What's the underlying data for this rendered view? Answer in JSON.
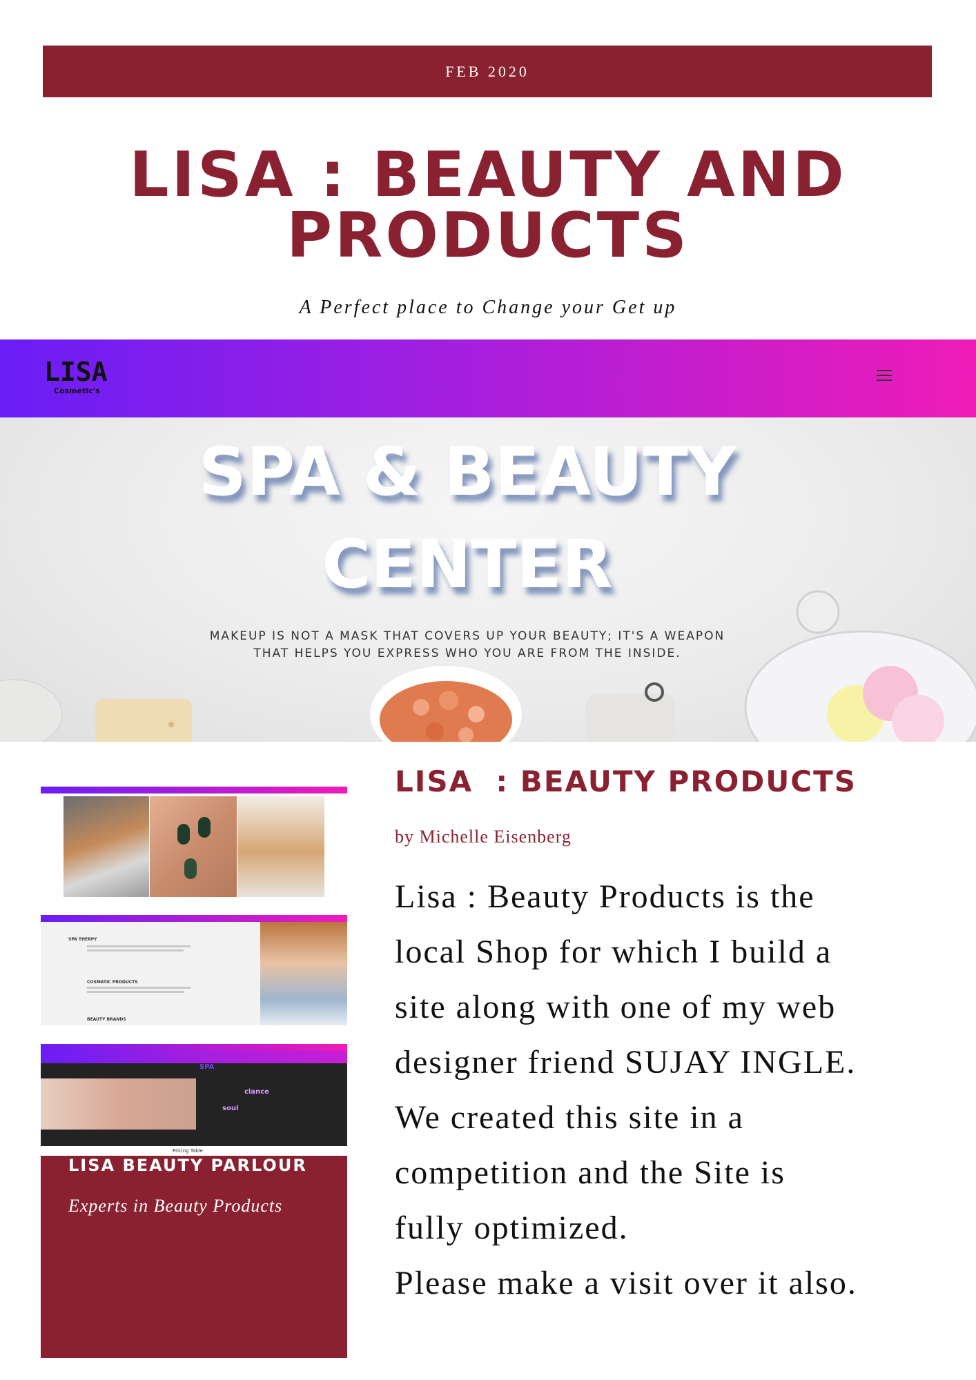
{
  "header": {
    "date": "FEB 2020",
    "title_line1": "LISA : BEAUTY AND",
    "title_line2": "PRODUCTS",
    "tagline": "A Perfect place to Change your Get up"
  },
  "hero": {
    "logo": "LISA",
    "logo_sub": "Cosmetic's",
    "headline_line1": "SPA & BEAUTY",
    "headline_line2": "CENTER",
    "quote_line1": "MAKEUP IS NOT A MASK THAT COVERS UP YOUR BEAUTY; IT'S A WEAPON",
    "quote_line2": "THAT HELPS YOU EXPRESS WHO YOU ARE FROM THE INSIDE."
  },
  "thumbnails": {
    "t2_items": [
      "SPA THERPY",
      "COSMATIC PRODUCTS",
      "BEAUTY BRANDS"
    ],
    "t3_line1": "SPA",
    "t3_line2": "clance",
    "t3_line3": "soul",
    "t3_caption": "Pricing Table"
  },
  "card": {
    "title": "LISA BEAUTY PARLOUR",
    "subtitle": "Experts in Beauty Products"
  },
  "article": {
    "title": "LISA  : BEAUTY PRODUCTS",
    "byline": "by Michelle Eisenberg",
    "body_lines": [
      "Lisa : Beauty Products is the",
      "local Shop for which I build a",
      "site along with one of my web",
      "designer friend SUJAY INGLE.",
      "We created this site in a",
      "competition and the Site is",
      "fully optimized.",
      "Please make a visit over it also."
    ]
  },
  "colors": {
    "brand": "#8a2131",
    "gradient_start": "#6a1ef5",
    "gradient_end": "#ef1cb7"
  }
}
